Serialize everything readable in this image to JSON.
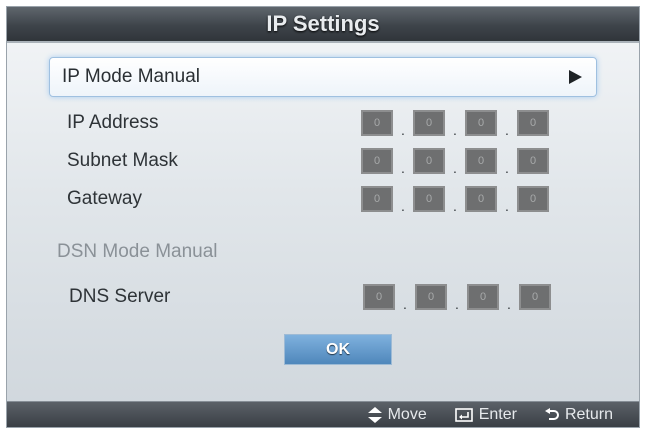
{
  "window": {
    "title": "IP Settings"
  },
  "ip_mode": {
    "label": "IP Mode Manual"
  },
  "fields": [
    {
      "label": "IP Address",
      "octets": [
        "0",
        "0",
        "0",
        "0"
      ]
    },
    {
      "label": "Subnet Mask",
      "octets": [
        "0",
        "0",
        "0",
        "0"
      ]
    },
    {
      "label": "Gateway",
      "octets": [
        "0",
        "0",
        "0",
        "0"
      ]
    }
  ],
  "dns_mode": {
    "label": "DSN Mode Manual"
  },
  "dns_server": {
    "label": "DNS Server",
    "octets": [
      "0",
      "0",
      "0",
      "0"
    ]
  },
  "ok_button": {
    "label": "OK"
  },
  "footer": {
    "move": "Move",
    "enter": "Enter",
    "return": "Return"
  },
  "separator": "."
}
